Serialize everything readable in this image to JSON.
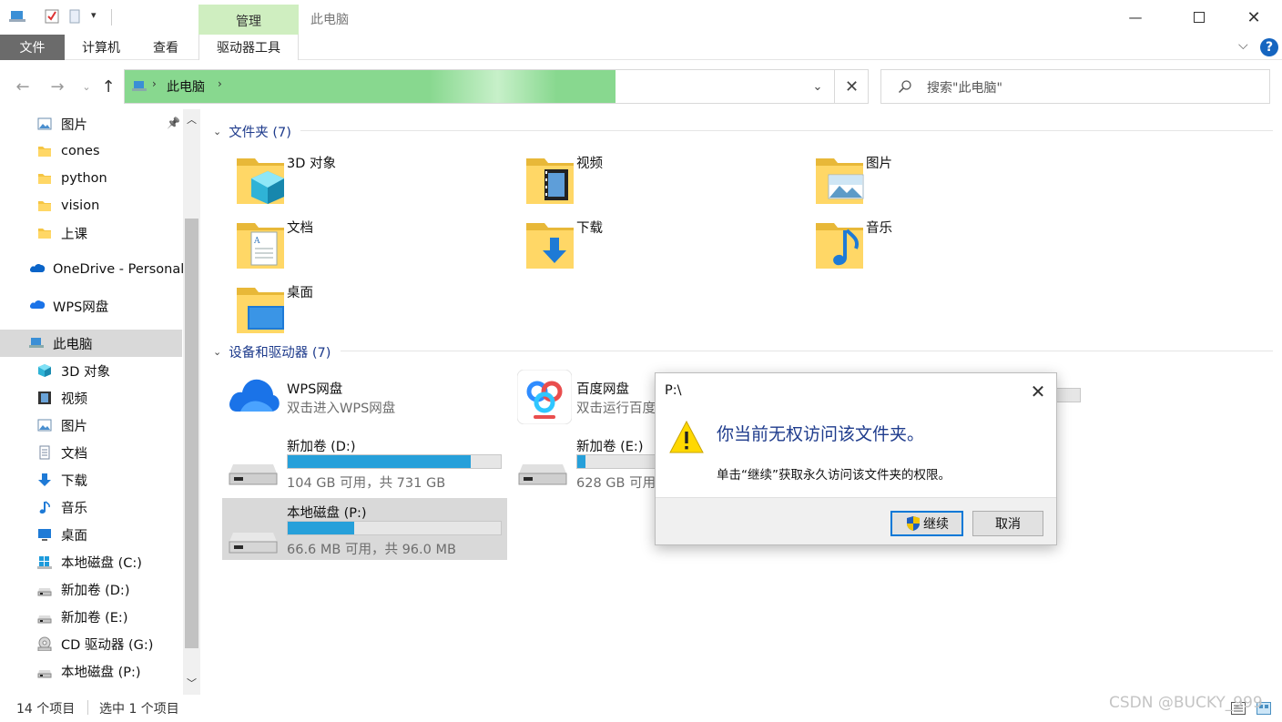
{
  "window": {
    "title": "此电脑"
  },
  "ribbon": {
    "contextual_group": "管理",
    "tabs": [
      "文件",
      "计算机",
      "查看",
      "驱动器工具"
    ]
  },
  "address": {
    "path": "此电脑",
    "progress": 0.66
  },
  "search": {
    "placeholder": "搜索\"此电脑\""
  },
  "nav": {
    "items": [
      {
        "label": "图片",
        "icon": "pictures-icon",
        "pinned": true
      },
      {
        "label": "cones",
        "icon": "folder-icon"
      },
      {
        "label": "python",
        "icon": "folder-icon"
      },
      {
        "label": "vision",
        "icon": "folder-icon"
      },
      {
        "label": "上课",
        "icon": "folder-icon"
      },
      {
        "label": "OneDrive - Personal",
        "icon": "onedrive-icon"
      },
      {
        "label": "WPS网盘",
        "icon": "wps-cloud-icon"
      },
      {
        "label": "此电脑",
        "icon": "this-pc-icon",
        "selected": true
      },
      {
        "label": "3D 对象",
        "icon": "3d-objects-icon"
      },
      {
        "label": "视频",
        "icon": "videos-icon"
      },
      {
        "label": "图片",
        "icon": "pictures-icon"
      },
      {
        "label": "文档",
        "icon": "documents-icon"
      },
      {
        "label": "下载",
        "icon": "downloads-icon"
      },
      {
        "label": "音乐",
        "icon": "music-icon"
      },
      {
        "label": "桌面",
        "icon": "desktop-icon"
      },
      {
        "label": "本地磁盘 (C:)",
        "icon": "windows-drive-icon"
      },
      {
        "label": "新加卷 (D:)",
        "icon": "drive-icon"
      },
      {
        "label": "新加卷 (E:)",
        "icon": "drive-icon"
      },
      {
        "label": "CD 驱动器 (G:)",
        "icon": "cd-drive-icon"
      },
      {
        "label": "本地磁盘 (P:)",
        "icon": "drive-icon"
      }
    ]
  },
  "folders": {
    "header": "文件夹 (7)",
    "items": [
      {
        "label": "3D 对象",
        "icon": "3d-objects-icon"
      },
      {
        "label": "视频",
        "icon": "videos-icon"
      },
      {
        "label": "图片",
        "icon": "pictures-icon"
      },
      {
        "label": "文档",
        "icon": "documents-icon"
      },
      {
        "label": "下载",
        "icon": "downloads-icon"
      },
      {
        "label": "音乐",
        "icon": "music-icon"
      },
      {
        "label": "桌面",
        "icon": "desktop-icon"
      }
    ]
  },
  "devices": {
    "header": "设备和驱动器 (7)",
    "wps": {
      "name": "WPS网盘",
      "sub": "双击进入WPS网盘"
    },
    "baidu": {
      "name": "百度网盘",
      "sub": "双击运行百度"
    },
    "d": {
      "name": "新加卷 (D:)",
      "free": "104 GB 可用，共 731 GB",
      "used_fraction": 0.86
    },
    "e": {
      "name": "新加卷 (E:)",
      "free": "628 GB 可用",
      "used_fraction": 0.04
    },
    "p": {
      "name": "本地磁盘 (P:)",
      "free": "66.6 MB 可用，共 96.0 MB",
      "used_fraction": 0.31
    }
  },
  "status": {
    "count": "14 个项目",
    "selected": "选中 1 个项目"
  },
  "dialog": {
    "title": "P:\\",
    "message": "你当前无权访问该文件夹。",
    "detail": "单击“继续”获取永久访问该文件夹的权限。",
    "continue_label": "继续",
    "cancel_label": "取消"
  },
  "watermark": "CSDN @BUCKY_999",
  "colors": {
    "accent": "#26a0da",
    "address_progress": "#88d88f",
    "manage_tab": "#cfeec0",
    "header_text": "#1e3b8c"
  }
}
